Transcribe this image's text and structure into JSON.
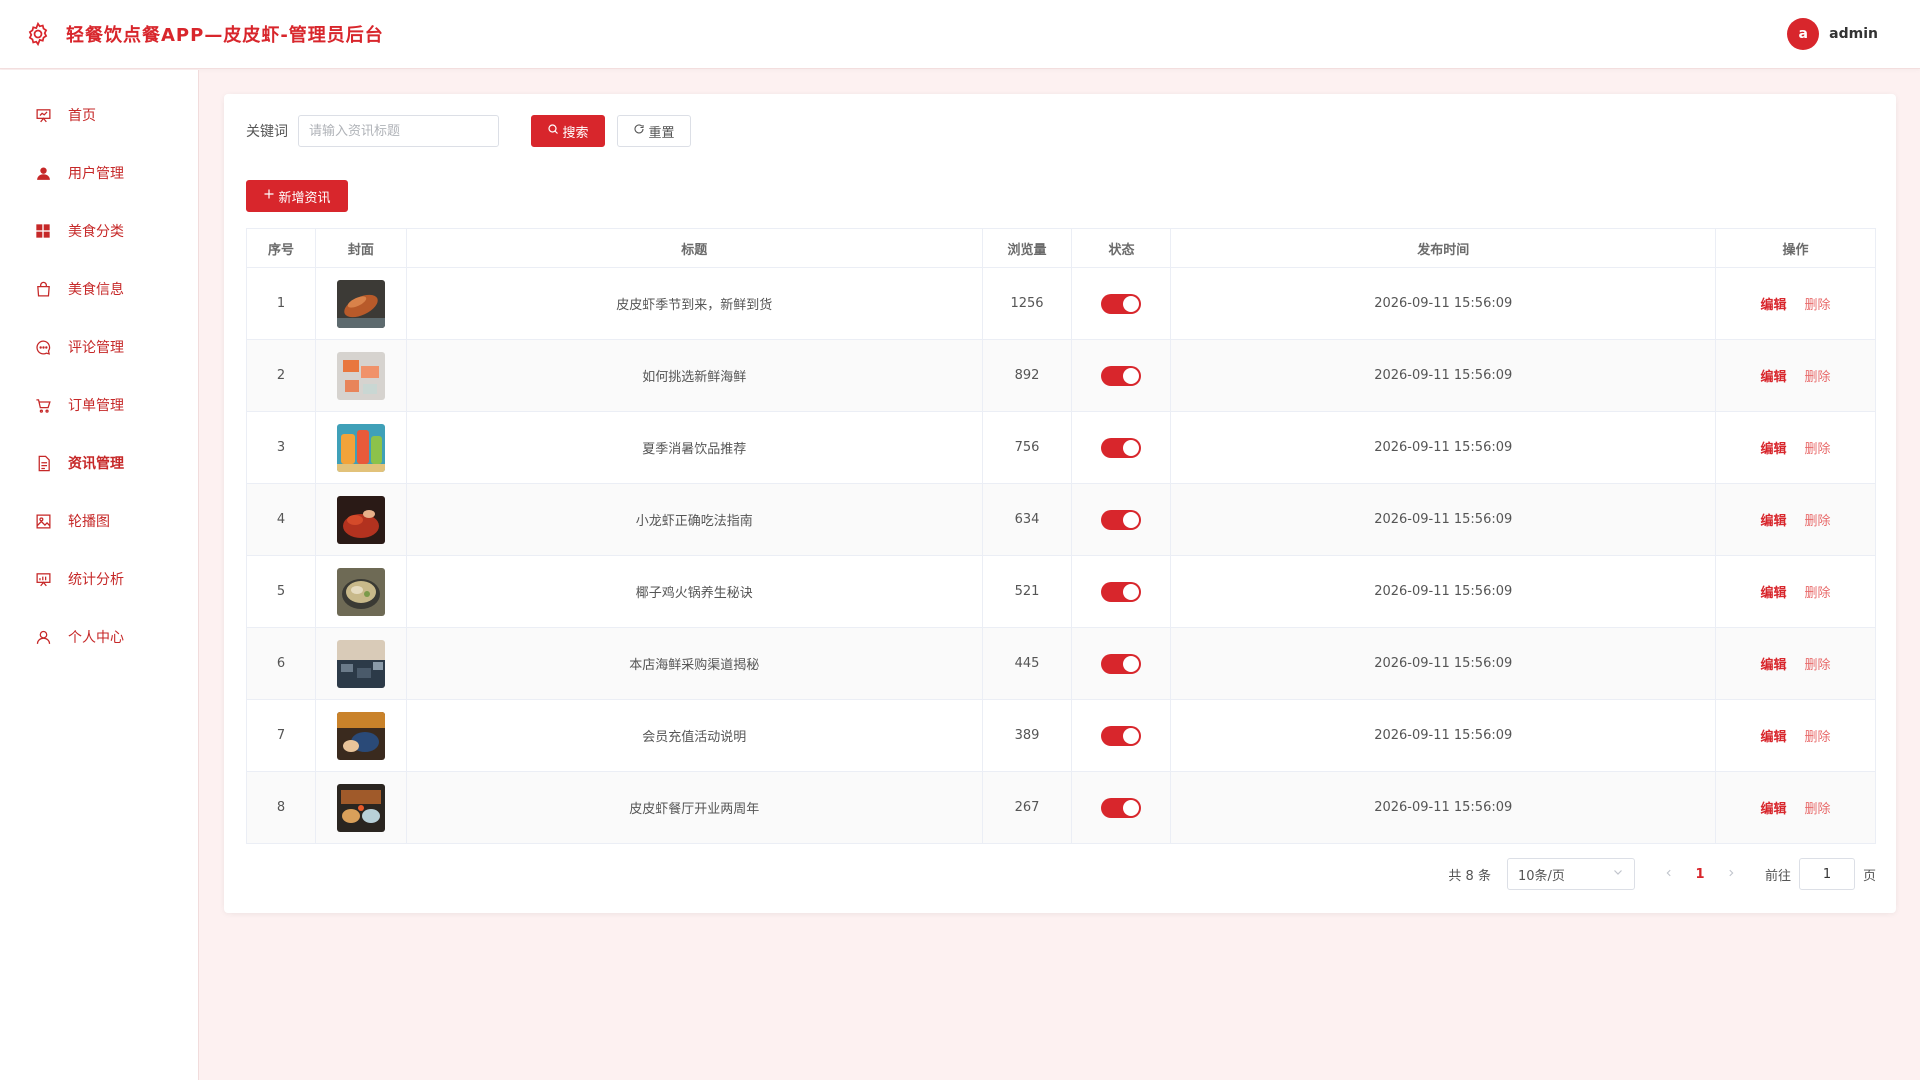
{
  "header": {
    "title": "轻餐饮点餐APP—皮皮虾-管理员后台",
    "avatar_letter": "a",
    "username": "admin"
  },
  "sidebar": {
    "items": [
      {
        "label": "首页",
        "icon": "presentation-icon"
      },
      {
        "label": "用户管理",
        "icon": "user-icon"
      },
      {
        "label": "美食分类",
        "icon": "grid-icon"
      },
      {
        "label": "美食信息",
        "icon": "shopping-bag-icon"
      },
      {
        "label": "评论管理",
        "icon": "chat-icon"
      },
      {
        "label": "订单管理",
        "icon": "cart-icon"
      },
      {
        "label": "资讯管理",
        "icon": "document-icon",
        "active": true
      },
      {
        "label": "轮播图",
        "icon": "image-icon"
      },
      {
        "label": "统计分析",
        "icon": "chart-board-icon"
      },
      {
        "label": "个人中心",
        "icon": "person-icon"
      }
    ]
  },
  "search": {
    "label": "关键词",
    "placeholder": "请输入资讯标题",
    "value": "",
    "search_label": "搜索",
    "reset_label": "重置"
  },
  "toolbar": {
    "add_label": "新增资讯"
  },
  "table": {
    "columns": [
      "序号",
      "封面",
      "标题",
      "浏览量",
      "状态",
      "发布时间",
      "操作"
    ],
    "edit_label": "编辑",
    "delete_label": "删除",
    "rows": [
      {
        "index": "1",
        "title": "皮皮虾季节到来，新鲜到货",
        "views": "1256",
        "enabled": true,
        "time": "2026-09-11 15:56:09"
      },
      {
        "index": "2",
        "title": "如何挑选新鲜海鲜",
        "views": "892",
        "enabled": true,
        "time": "2026-09-11 15:56:09"
      },
      {
        "index": "3",
        "title": "夏季消暑饮品推荐",
        "views": "756",
        "enabled": true,
        "time": "2026-09-11 15:56:09"
      },
      {
        "index": "4",
        "title": "小龙虾正确吃法指南",
        "views": "634",
        "enabled": true,
        "time": "2026-09-11 15:56:09"
      },
      {
        "index": "5",
        "title": "椰子鸡火锅养生秘诀",
        "views": "521",
        "enabled": true,
        "time": "2026-09-11 15:56:09"
      },
      {
        "index": "6",
        "title": "本店海鲜采购渠道揭秘",
        "views": "445",
        "enabled": true,
        "time": "2026-09-11 15:56:09"
      },
      {
        "index": "7",
        "title": "会员充值活动说明",
        "views": "389",
        "enabled": true,
        "time": "2026-09-11 15:56:09"
      },
      {
        "index": "8",
        "title": "皮皮虾餐厅开业两周年",
        "views": "267",
        "enabled": true,
        "time": "2026-09-11 15:56:09"
      }
    ]
  },
  "pagination": {
    "total": "共 8 条",
    "page_size": "10条/页",
    "current_page": "1",
    "goto_label": "前往",
    "goto_value": "1",
    "page_suffix": "页"
  },
  "colors": {
    "accent": "#d8262c",
    "background": "#fdf1f1"
  }
}
